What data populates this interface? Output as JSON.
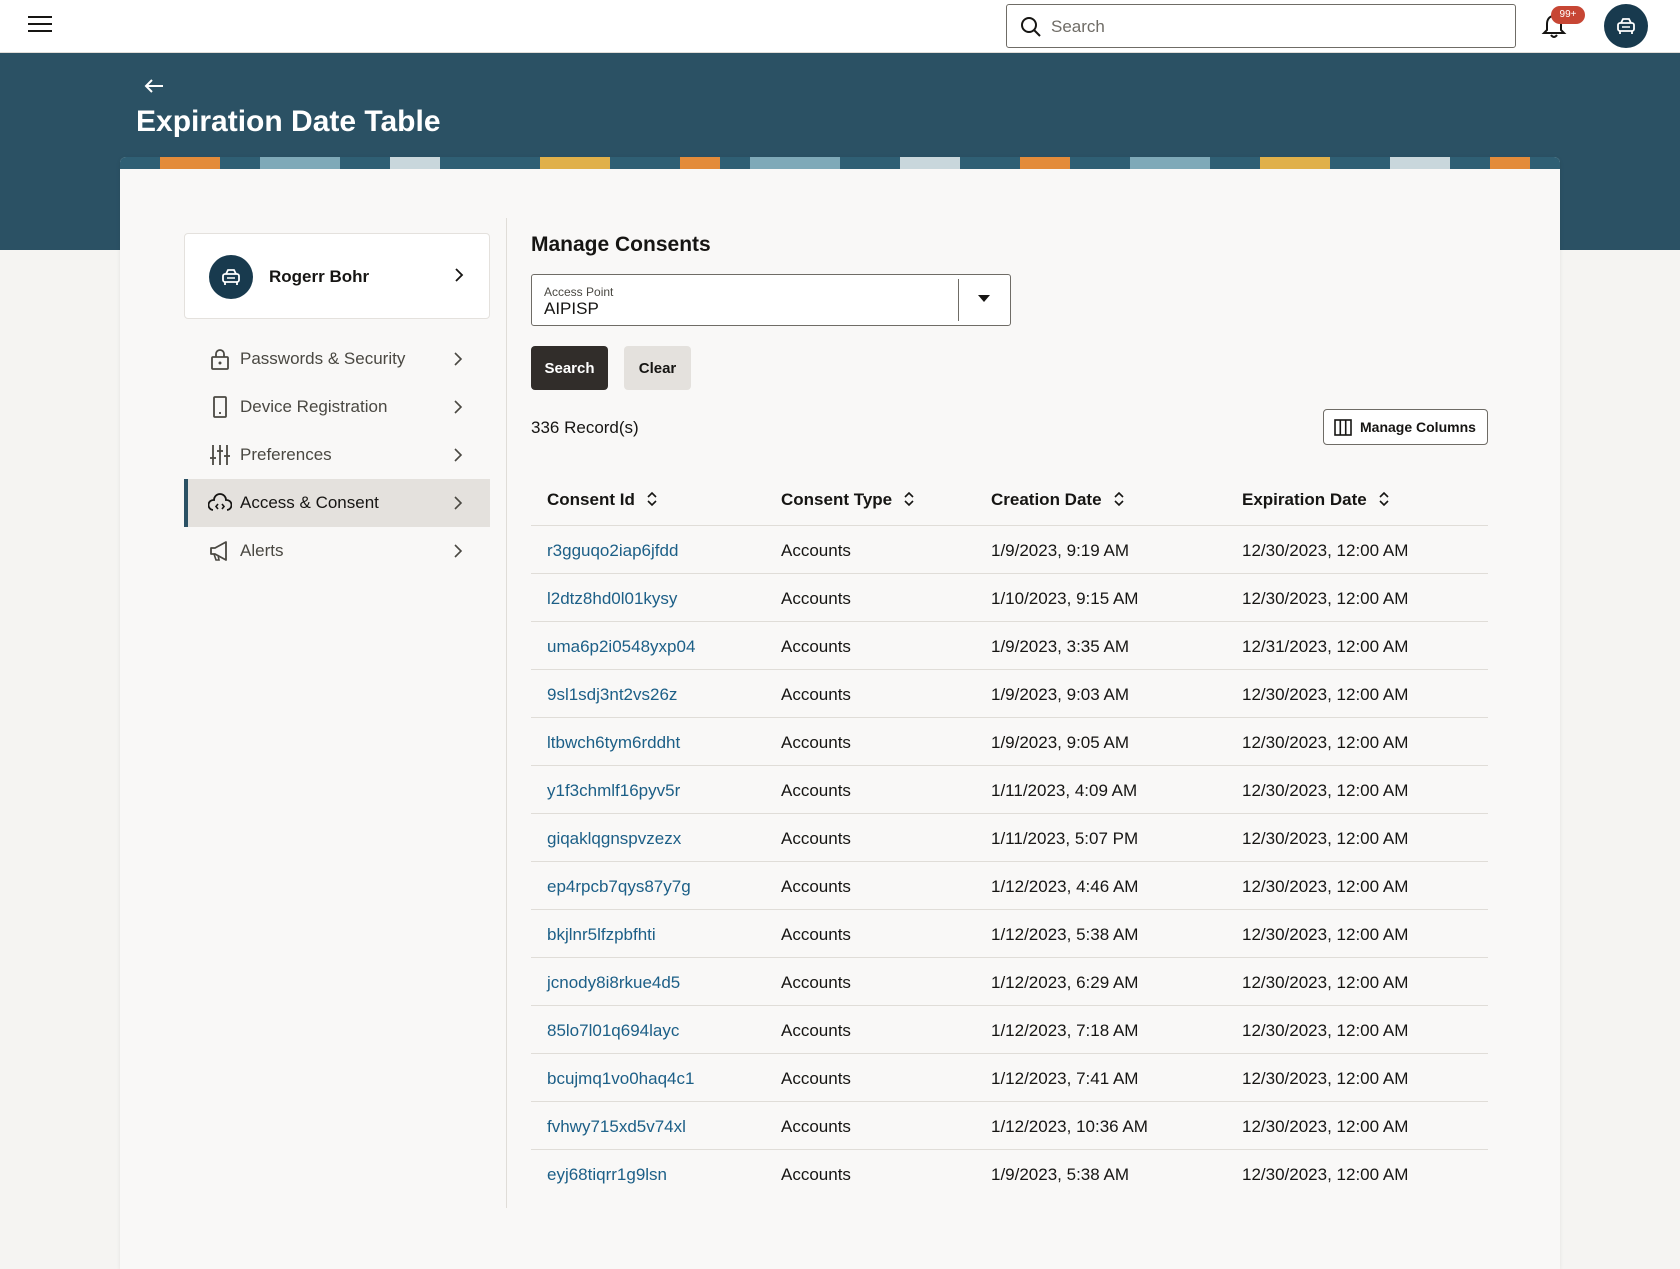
{
  "topbar": {
    "search_placeholder": "Search",
    "notification_badge": "99+",
    "icons": [
      "menu-icon",
      "search-icon",
      "bell-icon",
      "avatar-icon"
    ]
  },
  "header": {
    "title": "Expiration Date Table"
  },
  "sidebar": {
    "profile_name": "Rogerr Bohr",
    "items": [
      {
        "label": "Passwords & Security",
        "icon": "lock-icon",
        "active": false
      },
      {
        "label": "Device Registration",
        "icon": "device-icon",
        "active": false
      },
      {
        "label": "Preferences",
        "icon": "sliders-icon",
        "active": false
      },
      {
        "label": "Access & Consent",
        "icon": "cloud-code-icon",
        "active": true
      },
      {
        "label": "Alerts",
        "icon": "megaphone-icon",
        "active": false
      }
    ]
  },
  "main": {
    "section_title": "Manage Consents",
    "access_point": {
      "label": "Access Point",
      "value": "AIPISP"
    },
    "search_label": "Search",
    "clear_label": "Clear",
    "records_text": "336 Record(s)",
    "manage_columns_label": "Manage Columns"
  },
  "table": {
    "columns": [
      "Consent Id",
      "Consent Type",
      "Creation Date",
      "Expiration Date"
    ],
    "rows": [
      [
        "r3gguqo2iap6jfdd",
        "Accounts",
        "1/9/2023, 9:19 AM",
        "12/30/2023, 12:00 AM"
      ],
      [
        "l2dtz8hd0l01kysy",
        "Accounts",
        "1/10/2023, 9:15 AM",
        "12/30/2023, 12:00 AM"
      ],
      [
        "uma6p2i0548yxp04",
        "Accounts",
        "1/9/2023, 3:35 AM",
        "12/31/2023, 12:00 AM"
      ],
      [
        "9sl1sdj3nt2vs26z",
        "Accounts",
        "1/9/2023, 9:03 AM",
        "12/30/2023, 12:00 AM"
      ],
      [
        "ltbwch6tym6rddht",
        "Accounts",
        "1/9/2023, 9:05 AM",
        "12/30/2023, 12:00 AM"
      ],
      [
        "y1f3chmlf16pyv5r",
        "Accounts",
        "1/11/2023, 4:09 AM",
        "12/30/2023, 12:00 AM"
      ],
      [
        "giqaklqgnspvzezx",
        "Accounts",
        "1/11/2023, 5:07 PM",
        "12/30/2023, 12:00 AM"
      ],
      [
        "ep4rpcb7qys87y7g",
        "Accounts",
        "1/12/2023, 4:46 AM",
        "12/30/2023, 12:00 AM"
      ],
      [
        "bkjlnr5lfzpbfhti",
        "Accounts",
        "1/12/2023, 5:38 AM",
        "12/30/2023, 12:00 AM"
      ],
      [
        "jcnody8i8rkue4d5",
        "Accounts",
        "1/12/2023, 6:29 AM",
        "12/30/2023, 12:00 AM"
      ],
      [
        "85lo7l01q694layc",
        "Accounts",
        "1/12/2023, 7:18 AM",
        "12/30/2023, 12:00 AM"
      ],
      [
        "bcujmq1vo0haq4c1",
        "Accounts",
        "1/12/2023, 7:41 AM",
        "12/30/2023, 12:00 AM"
      ],
      [
        "fvhwy715xd5v74xl",
        "Accounts",
        "1/12/2023, 10:36 AM",
        "12/30/2023, 12:00 AM"
      ],
      [
        "eyj68tiqrr1g9lsn",
        "Accounts",
        "1/9/2023, 5:38 AM",
        "12/30/2023, 12:00 AM"
      ]
    ]
  },
  "colors": {
    "banner": "#2b5164",
    "primary_button": "#312d2a",
    "link": "#1c5f87",
    "badge": "#c74634",
    "avatar": "#183a4e"
  }
}
